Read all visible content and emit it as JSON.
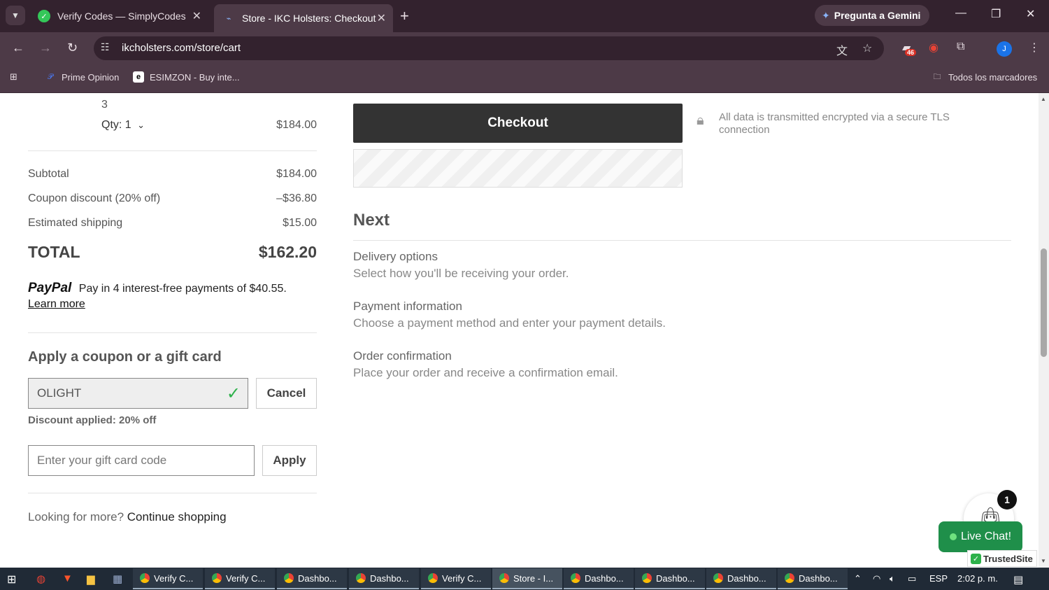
{
  "browser": {
    "tabs": [
      {
        "title": "Verify Codes — SimplyCodes",
        "active": false
      },
      {
        "title": "Store - IKC Holsters: Checkout",
        "active": true
      }
    ],
    "gemini_label": "Pregunta a Gemini",
    "url": "ikcholsters.com/store/cart",
    "extension_badge": "46",
    "profile_initial": "J",
    "bookmarks": [
      {
        "label": "Prime Opinion"
      },
      {
        "label": "ESIMZON - Buy inte..."
      }
    ],
    "all_bookmarks_label": "Todos los marcadores"
  },
  "cart": {
    "item_tail": "3",
    "qty_label": "Qty: 1",
    "item_price": "$184.00",
    "subtotal_label": "Subtotal",
    "subtotal_value": "$184.00",
    "coupon_label": "Coupon discount (20% off)",
    "coupon_value": "–$36.80",
    "shipping_label": "Estimated shipping",
    "shipping_value": "$15.00",
    "total_label": "TOTAL",
    "total_value": "$162.20"
  },
  "paypal": {
    "logo": "PayPal",
    "message": "Pay in 4 interest-free payments of $40.55.",
    "learn_more": "Learn more"
  },
  "coupon": {
    "title": "Apply a coupon or a gift card",
    "code_value": "OLIGHT",
    "cancel_label": "Cancel",
    "applied_text": "Discount applied: 20% off",
    "gift_placeholder": "Enter your gift card code",
    "apply_label": "Apply"
  },
  "footer_link": {
    "prefix": "Looking for more?",
    "link": "Continue shopping"
  },
  "checkout": {
    "button_label": "Checkout",
    "secure_text": "All data is transmitted encrypted via a secure TLS connection"
  },
  "next": {
    "title": "Next",
    "steps": [
      {
        "title": "Delivery options",
        "desc": "Select how you'll be receiving your order."
      },
      {
        "title": "Payment information",
        "desc": "Choose a payment method and enter your payment details."
      },
      {
        "title": "Order confirmation",
        "desc": "Place your order and receive a confirmation email."
      }
    ]
  },
  "widgets": {
    "cart_count": "1",
    "live_chat": "Live Chat!",
    "trusted": "TrustedSite"
  },
  "taskbar": {
    "items": [
      {
        "label": "Verify C..."
      },
      {
        "label": "Verify C..."
      },
      {
        "label": "Dashbo..."
      },
      {
        "label": "Dashbo..."
      },
      {
        "label": "Verify C..."
      },
      {
        "label": "Store - I..."
      },
      {
        "label": "Dashbo..."
      },
      {
        "label": "Dashbo..."
      },
      {
        "label": "Dashbo..."
      },
      {
        "label": "Dashbo..."
      }
    ],
    "language": "ESP",
    "clock": "2:02 p. m."
  }
}
